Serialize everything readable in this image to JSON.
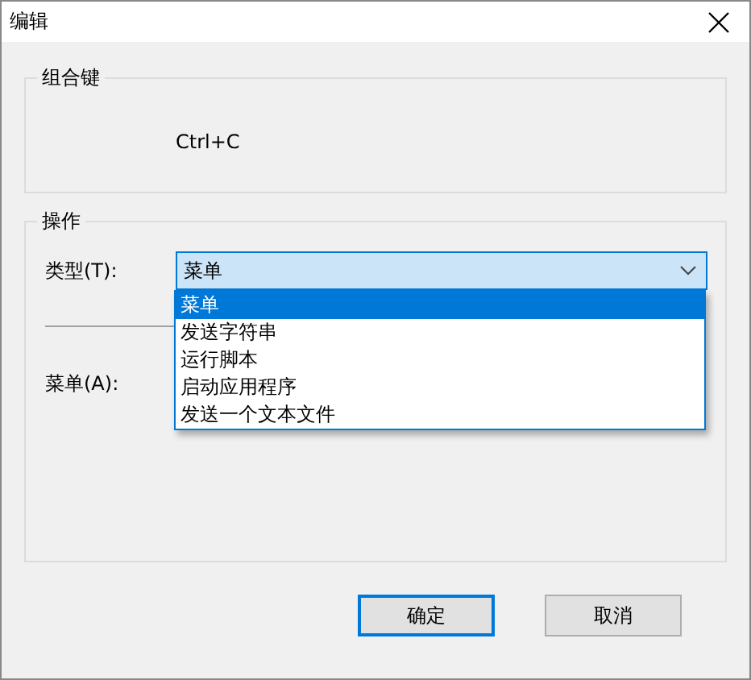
{
  "window": {
    "title": "编辑"
  },
  "hotkey_group": {
    "title": "组合键",
    "value": "Ctrl+C"
  },
  "action_group": {
    "title": "操作",
    "type_label": "类型(T):",
    "type_value": "菜单",
    "expanded": true,
    "options": [
      {
        "label": "菜单",
        "selected": true
      },
      {
        "label": "发送字符串",
        "selected": false
      },
      {
        "label": "运行脚本",
        "selected": false
      },
      {
        "label": "启动应用程序",
        "selected": false
      },
      {
        "label": "发送一个文本文件",
        "selected": false
      }
    ],
    "menu_label": "菜单(A):"
  },
  "buttons": [
    {
      "label": "确定",
      "default": true
    },
    {
      "label": "取消",
      "default": false
    }
  ]
}
